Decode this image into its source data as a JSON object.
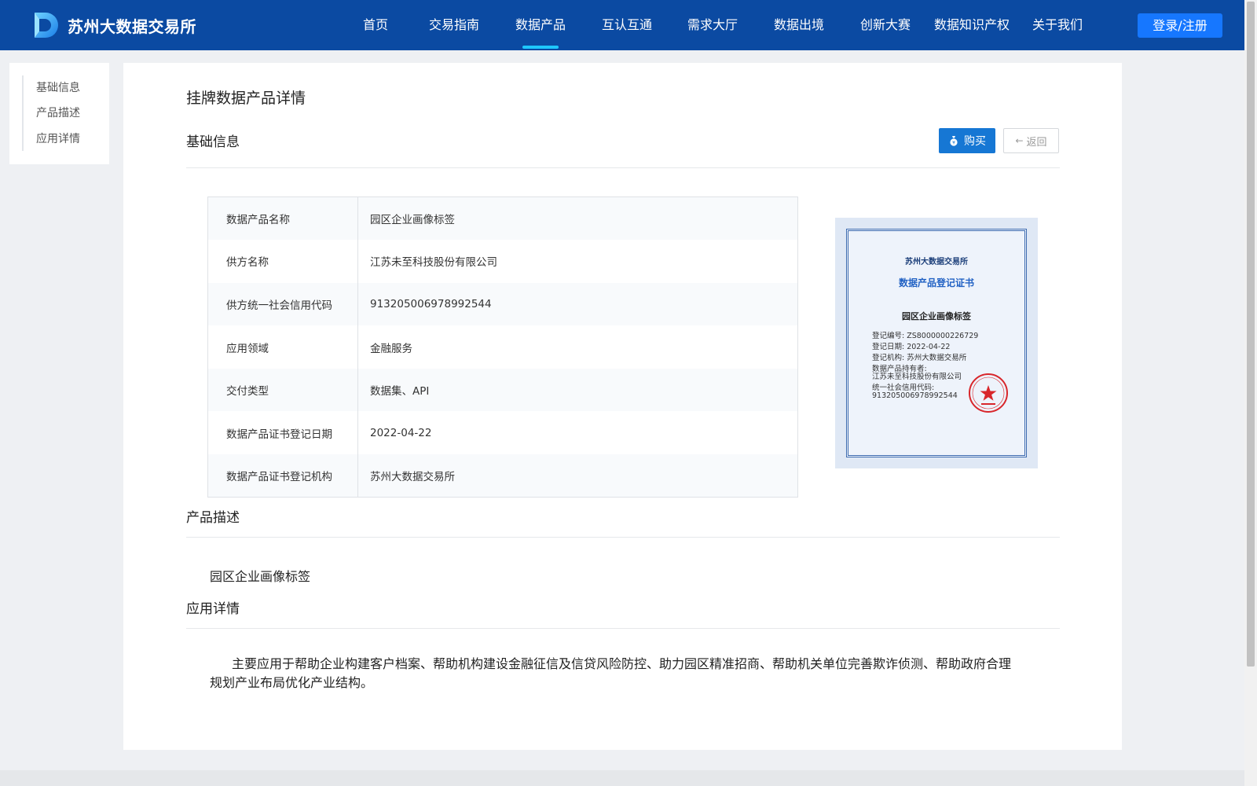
{
  "header": {
    "site_name": "苏州大数据交易所",
    "nav": [
      {
        "label": "首页"
      },
      {
        "label": "交易指南"
      },
      {
        "label": "数据产品",
        "active": true
      },
      {
        "label": "互认互通"
      },
      {
        "label": "需求大厅"
      },
      {
        "label": "数据出境"
      },
      {
        "label": "创新大赛"
      },
      {
        "label": "数据知识产权"
      },
      {
        "label": "关于我们"
      }
    ],
    "login_label": "登录/注册"
  },
  "sidebar": {
    "items": [
      {
        "label": "基础信息"
      },
      {
        "label": "产品描述"
      },
      {
        "label": "应用详情"
      }
    ]
  },
  "main": {
    "page_title": "挂牌数据产品详情",
    "basic_title": "基础信息",
    "buy_label": "购买",
    "back_label": "返回",
    "info_rows": [
      {
        "key": "数据产品名称",
        "value": "园区企业画像标签"
      },
      {
        "key": "供方名称",
        "value": "江苏未至科技股份有限公司"
      },
      {
        "key": "供方统一社会信用代码",
        "value": "913205006978992544"
      },
      {
        "key": "应用领域",
        "value": "金融服务"
      },
      {
        "key": "交付类型",
        "value": "数据集、API"
      },
      {
        "key": "数据产品证书登记日期",
        "value": "2022-04-22"
      },
      {
        "key": "数据产品证书登记机构",
        "value": "苏州大数据交易所"
      }
    ],
    "certificate": {
      "org": "苏州大数据交易所",
      "title": "数据产品登记证书",
      "product": "园区企业画像标签",
      "lines": [
        "登记编号: ZS8000000226729",
        "登记日期: 2022-04-22",
        "登记机构: 苏州大数据交易所",
        "数据产品持有者:",
        "江苏未至科技股份有限公司",
        "统一社会信用代码:",
        "913205006978992544"
      ]
    },
    "desc_title": "产品描述",
    "desc_text": "园区企业画像标签",
    "app_title": "应用详情",
    "app_text": "主要应用于帮助企业构建客户档案、帮助机构建设金融征信及信贷风险防控、助力园区精准招商、帮助机关单位完善欺诈侦测、帮助政府合理规划产业布局优化产业结构。"
  },
  "colors": {
    "header_bg": "#0b4aa2",
    "accent": "#1677ff",
    "nav_active_underline": "#1ec7ff",
    "buy_button": "#1677d4"
  }
}
